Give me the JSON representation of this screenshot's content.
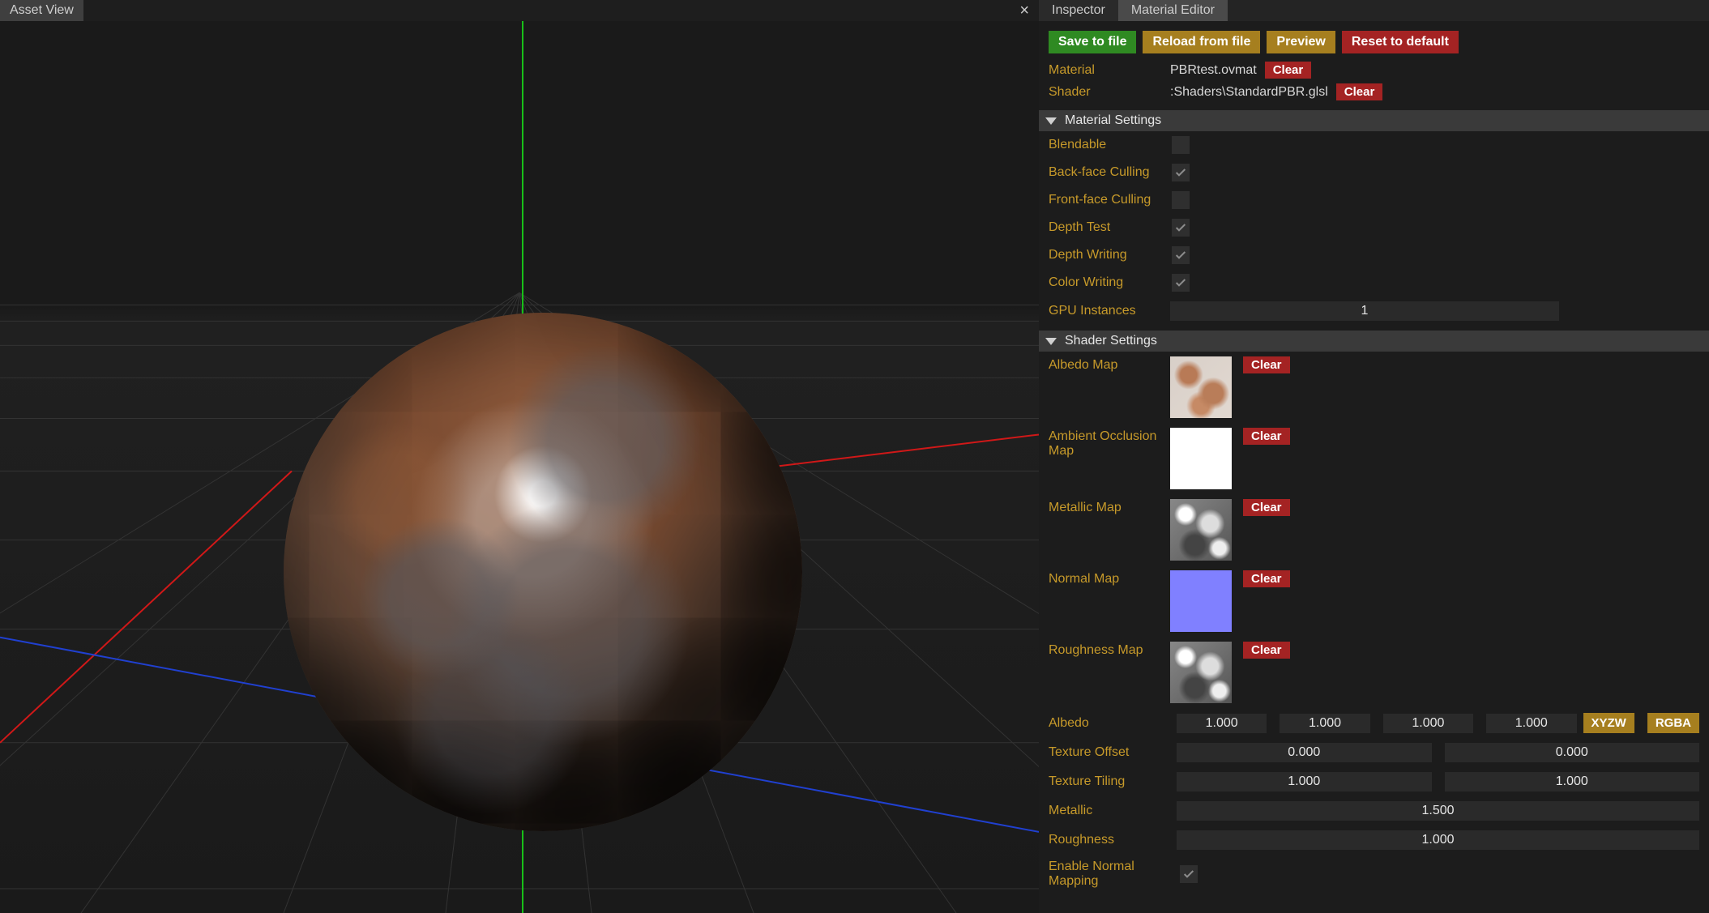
{
  "left": {
    "tabs": [
      {
        "label": "Asset View"
      }
    ]
  },
  "right": {
    "tabs": {
      "inspector": "Inspector",
      "material_editor": "Material Editor"
    },
    "actions": {
      "save": "Save to file",
      "reload": "Reload from file",
      "preview": "Preview",
      "reset": "Reset to default"
    },
    "meta": {
      "material_k": "Material",
      "material_v": "PBRtest.ovmat",
      "shader_k": "Shader",
      "shader_v": ":Shaders\\StandardPBR.glsl",
      "clear": "Clear"
    },
    "sections": {
      "mat": "Material Settings",
      "shader": "Shader Settings"
    },
    "mat_settings": {
      "blendable": {
        "label": "Blendable",
        "checked": false
      },
      "backface": {
        "label": "Back-face Culling",
        "checked": true
      },
      "frontface": {
        "label": "Front-face Culling",
        "checked": false
      },
      "depthtest": {
        "label": "Depth Test",
        "checked": true
      },
      "depthwrite": {
        "label": "Depth Writing",
        "checked": true
      },
      "colorwrite": {
        "label": "Color Writing",
        "checked": true
      },
      "gpu_inst": {
        "label": "GPU Instances",
        "value": "1"
      }
    },
    "shader_settings": {
      "maps": {
        "albedo": {
          "label": "Albedo Map"
        },
        "ao": {
          "label": "Ambient Occlusion Map"
        },
        "metallic": {
          "label": "Metallic Map"
        },
        "normal": {
          "label": "Normal Map"
        },
        "rough": {
          "label": "Roughness Map"
        }
      },
      "clear": "Clear",
      "albedo_vec": {
        "label": "Albedo",
        "x": "1.000",
        "y": "1.000",
        "z": "1.000",
        "w": "1.000",
        "xyzw": "XYZW",
        "rgba": "RGBA"
      },
      "tex_offset": {
        "label": "Texture Offset",
        "x": "0.000",
        "y": "0.000"
      },
      "tex_tiling": {
        "label": "Texture Tiling",
        "x": "1.000",
        "y": "1.000"
      },
      "metallic_f": {
        "label": "Metallic",
        "v": "1.500"
      },
      "rough_f": {
        "label": "Roughness",
        "v": "1.000"
      },
      "enable_nm": {
        "label": "Enable Normal Mapping",
        "checked": true
      }
    }
  }
}
